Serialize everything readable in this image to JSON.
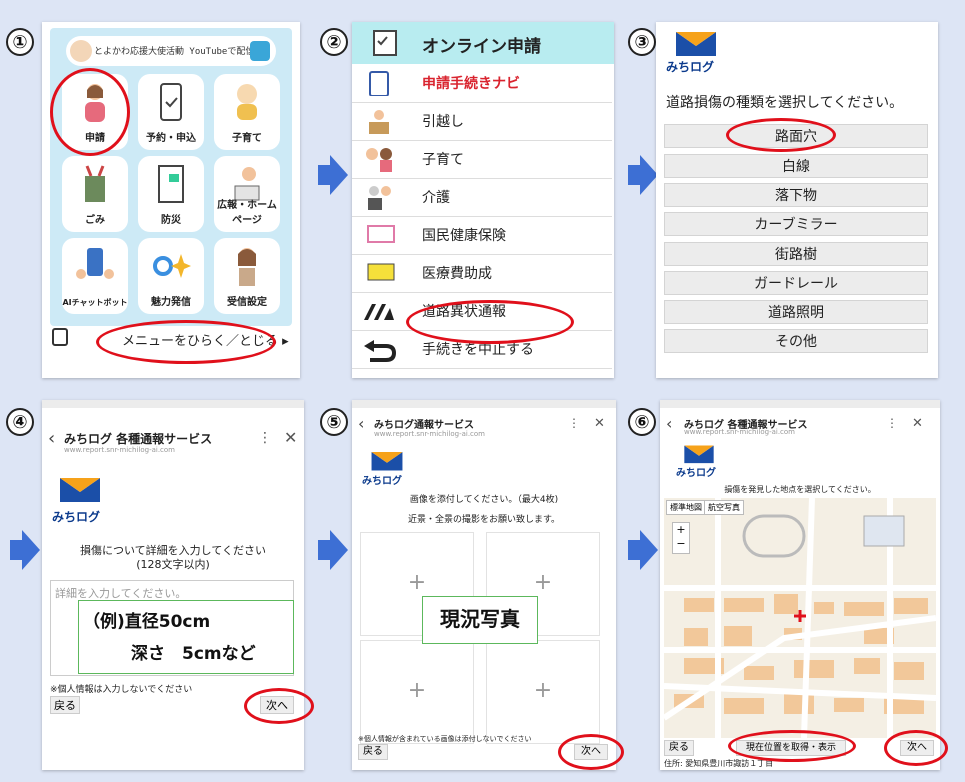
{
  "steps": [
    "①",
    "②",
    "③",
    "④",
    "⑤",
    "⑥"
  ],
  "panel1": {
    "banner": "とよかわ応援大使活動 YouTubeで配信中",
    "tiles": [
      "申請",
      "予約・申込",
      "子育て",
      "ごみ",
      "防災",
      "広報・ホームページ",
      "AIチャットボット",
      "魅力発信",
      "受信設定"
    ],
    "menu_label": "メニューをひらく／とじる ▸"
  },
  "panel2": {
    "header": "オンライン申請",
    "items": [
      "申請手続きナビ",
      "引越し",
      "子育て",
      "介護",
      "国民健康保険",
      "医療費助成",
      "道路異状通報",
      "手続きを中止する"
    ],
    "highlight_color": "#d9232e"
  },
  "panel3": {
    "logo_text": "みちログ",
    "prompt": "道路損傷の種類を選択してください。",
    "options": [
      "路面穴",
      "白線",
      "落下物",
      "カーブミラー",
      "街路樹",
      "ガードレール",
      "道路照明",
      "その他"
    ]
  },
  "panel4": {
    "title": "みちログ 各種通報サービス",
    "url": "www.report.snr-michilog-ai.com",
    "logo_text": "みちログ",
    "instruction": "損傷について詳細を入力してください",
    "limit": "(128文字以内)",
    "placeholder": "詳細を入力してください。",
    "example_line1": "（例)直径50cm",
    "example_line2": "深さ　5cmなど",
    "note": "※個人情報は入力しないでください",
    "back": "戻る",
    "next": "次へ"
  },
  "panel5": {
    "title": "みちログ通報サービス",
    "url": "www.report.snr-michilog-ai.com",
    "logo_text": "みちログ",
    "instruction1": "画像を添付してください。（最大4枚)",
    "instruction2": "近景・全景の撮影をお願い致します。",
    "plus": "+",
    "photo_label": "現況写真",
    "note": "※個人情報が含まれている画像は添付しないでください",
    "back": "戻る",
    "next": "次へ"
  },
  "panel6": {
    "title": "みちログ 各種通報サービス",
    "url": "www.report.snr-michilog-ai.com",
    "logo_text": "みちログ",
    "instruction": "損傷を発見した地点を選択してください。",
    "tab_standard": "標準地図",
    "tab_aerial": "航空写真",
    "back": "戻る",
    "locate": "現在位置を取得・表示",
    "next": "次へ",
    "address": "住所: 愛知県豊川市諏訪１丁目"
  },
  "icons": {
    "menu": "keypad-icon",
    "arrow": "right-arrow-icon",
    "back": "u-turn-icon"
  }
}
